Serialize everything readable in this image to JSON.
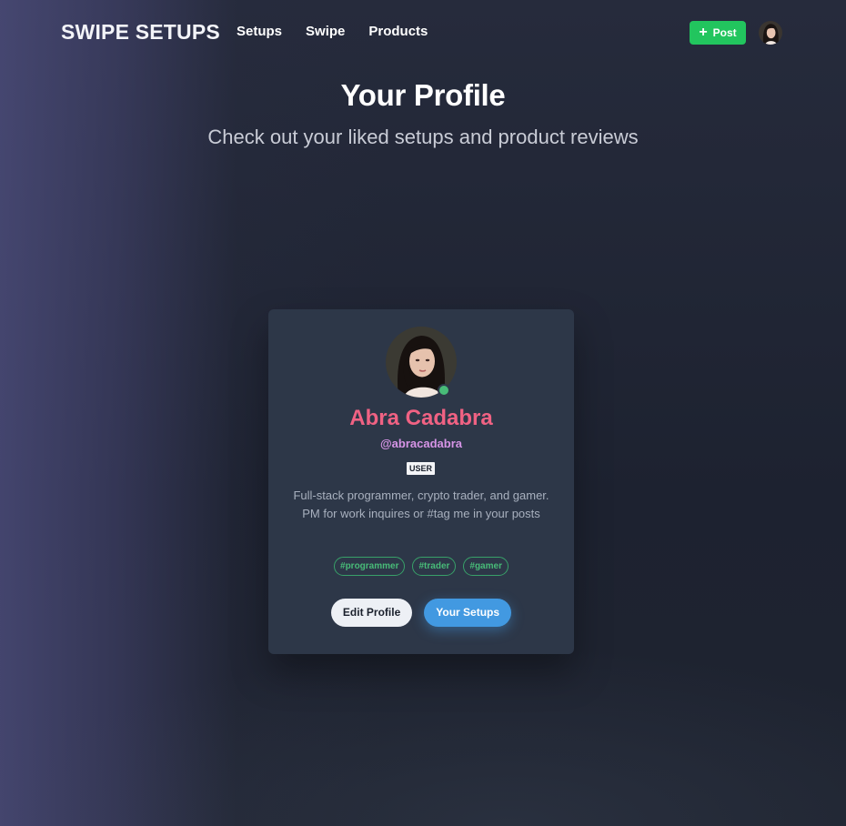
{
  "nav": {
    "brand": "SWIPE SETUPS",
    "links": [
      "Setups",
      "Swipe",
      "Products"
    ],
    "post_label": "Post",
    "post_icon": "plus-icon",
    "post_color": "#22c55e"
  },
  "hero": {
    "title": "Your Profile",
    "subtitle": "Check out your liked setups and product reviews"
  },
  "profile": {
    "name": "Abra Cadabra",
    "handle": "@abracadabra",
    "role": "USER",
    "bio": "Full-stack programmer, crypto trader, and gamer. PM for work inquires or #tag me in your posts",
    "tags": [
      "#programmer",
      "#trader",
      "#gamer"
    ],
    "online": true,
    "name_color": "#f06283",
    "handle_color": "#d694e6",
    "edit_label": "Edit Profile",
    "setups_label": "Your Setups"
  }
}
